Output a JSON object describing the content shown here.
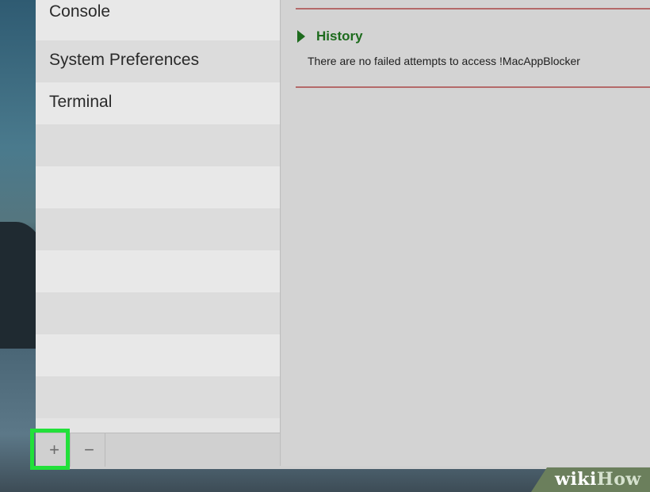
{
  "sidebar": {
    "items": [
      {
        "label": "Console"
      },
      {
        "label": "System Preferences"
      },
      {
        "label": "Terminal"
      },
      {
        "label": ""
      },
      {
        "label": ""
      },
      {
        "label": ""
      },
      {
        "label": ""
      },
      {
        "label": ""
      },
      {
        "label": ""
      },
      {
        "label": ""
      }
    ],
    "footer": {
      "add_label": "+",
      "remove_label": "−"
    }
  },
  "main": {
    "history": {
      "title": "History",
      "message": "There are no failed attempts to access !MacAppBlocker"
    }
  },
  "watermark": {
    "part1": "wiki",
    "part2": "How"
  },
  "colors": {
    "highlight": "#22e03a",
    "history_title": "#1d6b1d",
    "divider": "#b46a6a"
  },
  "icons": {
    "history_toggle": "disclosure-triangle-icon"
  }
}
